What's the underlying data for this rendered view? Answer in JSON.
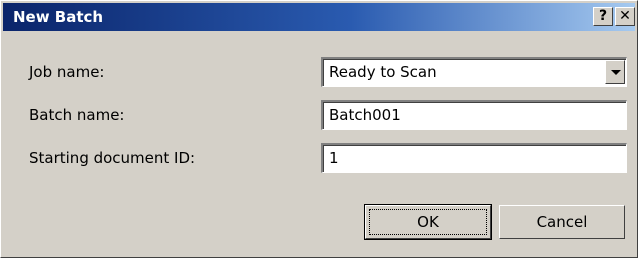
{
  "window": {
    "title": "New Batch",
    "help_button": "?",
    "close_button": "✕"
  },
  "form": {
    "job_name_label": "Job name:",
    "job_name_value": "Ready to Scan",
    "batch_name_label": "Batch name:",
    "batch_name_value": "Batch001",
    "start_id_label": "Starting document ID:",
    "start_id_value": "1"
  },
  "buttons": {
    "ok": "OK",
    "cancel": "Cancel"
  },
  "colors": {
    "titlebar_start": "#0a246a",
    "titlebar_end": "#a6caf0",
    "dialog_face": "#d4d0c8"
  }
}
